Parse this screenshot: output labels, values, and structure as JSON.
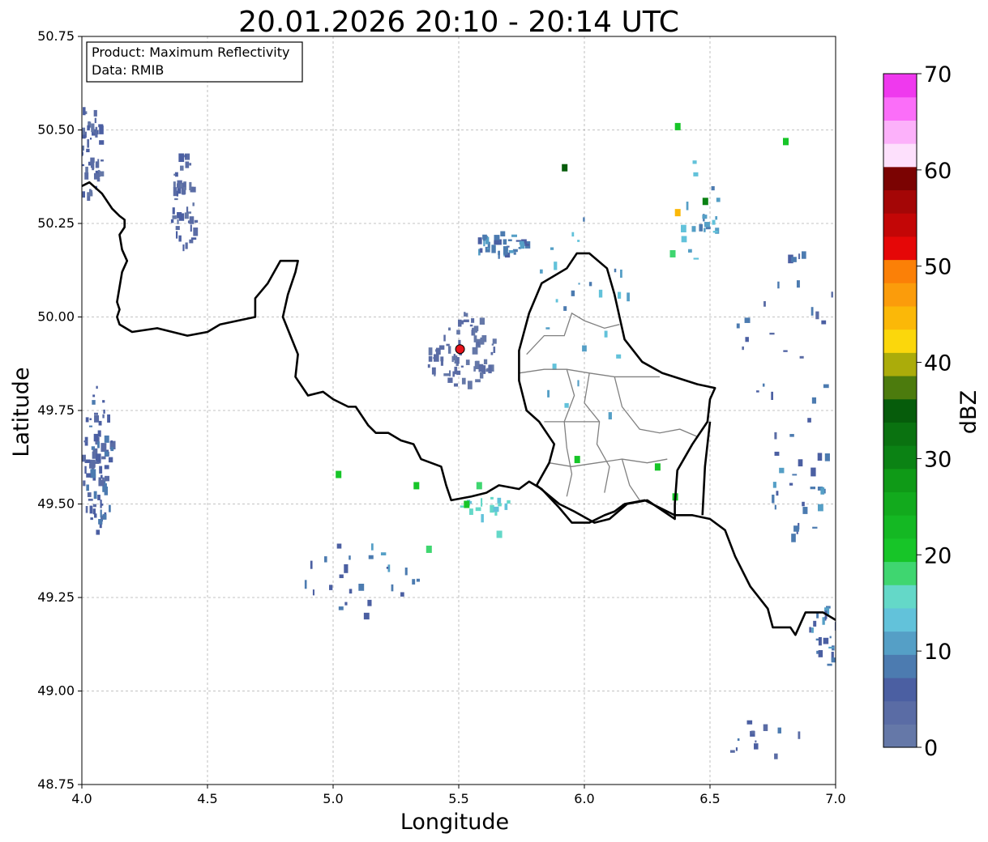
{
  "title": "20.01.2026 20:10 - 20:14 UTC",
  "info_box": {
    "product": "Product: Maximum Reflectivity",
    "data": "Data: RMIB"
  },
  "map": {
    "type": "radar-map",
    "xlabel": "Longitude",
    "ylabel": "Latitude",
    "xlim": [
      4.0,
      7.0
    ],
    "ylim": [
      48.75,
      50.75
    ],
    "xticks": [
      4.0,
      4.5,
      5.0,
      5.5,
      6.0,
      6.5,
      7.0
    ],
    "xtick_labels": [
      "4.0",
      "4.5",
      "5.0",
      "5.5",
      "6.0",
      "6.5",
      "7.0"
    ],
    "yticks": [
      48.75,
      49.0,
      49.25,
      49.5,
      49.75,
      50.0,
      50.25,
      50.5,
      50.75
    ],
    "ytick_labels": [
      "48.75",
      "49.00",
      "49.25",
      "49.50",
      "49.75",
      "50.00",
      "50.25",
      "50.50",
      "50.75"
    ],
    "grid": true,
    "radar_site": {
      "lon": 5.505,
      "lat": 49.914,
      "color": "#e8141c"
    },
    "national_border": [
      [
        4.0,
        50.35
      ],
      [
        4.03,
        50.36
      ],
      [
        4.08,
        50.33
      ],
      [
        4.12,
        50.29
      ],
      [
        4.15,
        50.27
      ],
      [
        4.17,
        50.26
      ],
      [
        4.17,
        50.24
      ],
      [
        4.15,
        50.22
      ],
      [
        4.16,
        50.18
      ],
      [
        4.18,
        50.15
      ],
      [
        4.16,
        50.12
      ],
      [
        4.14,
        50.04
      ],
      [
        4.15,
        50.02
      ],
      [
        4.14,
        50.0
      ],
      [
        4.15,
        49.98
      ],
      [
        4.2,
        49.96
      ],
      [
        4.3,
        49.97
      ],
      [
        4.42,
        49.95
      ],
      [
        4.5,
        49.96
      ],
      [
        4.55,
        49.98
      ],
      [
        4.62,
        49.99
      ],
      [
        4.69,
        50.0
      ],
      [
        4.69,
        50.05
      ],
      [
        4.74,
        50.09
      ],
      [
        4.79,
        50.15
      ],
      [
        4.86,
        50.15
      ],
      [
        4.85,
        50.12
      ],
      [
        4.82,
        50.06
      ],
      [
        4.8,
        50.0
      ],
      [
        4.83,
        49.95
      ],
      [
        4.86,
        49.9
      ],
      [
        4.85,
        49.84
      ],
      [
        4.9,
        49.79
      ],
      [
        4.96,
        49.8
      ],
      [
        5.0,
        49.78
      ],
      [
        5.06,
        49.76
      ],
      [
        5.09,
        49.76
      ],
      [
        5.14,
        49.71
      ],
      [
        5.17,
        49.69
      ],
      [
        5.22,
        49.69
      ],
      [
        5.27,
        49.67
      ],
      [
        5.32,
        49.66
      ],
      [
        5.35,
        49.62
      ],
      [
        5.43,
        49.6
      ],
      [
        5.45,
        49.55
      ],
      [
        5.47,
        49.51
      ],
      [
        5.55,
        49.52
      ],
      [
        5.61,
        49.53
      ],
      [
        5.66,
        49.55
      ],
      [
        5.74,
        49.54
      ],
      [
        5.78,
        49.56
      ],
      [
        5.83,
        49.54
      ],
      [
        5.9,
        49.49
      ],
      [
        5.95,
        49.45
      ],
      [
        5.97,
        49.45
      ],
      [
        6.02,
        49.45
      ],
      [
        6.08,
        49.47
      ],
      [
        6.12,
        49.48
      ],
      [
        6.16,
        49.5
      ],
      [
        6.24,
        49.51
      ],
      [
        6.36,
        49.47
      ],
      [
        6.43,
        49.47
      ],
      [
        6.5,
        49.46
      ],
      [
        6.56,
        49.43
      ],
      [
        6.6,
        49.36
      ],
      [
        6.66,
        49.28
      ],
      [
        6.73,
        49.22
      ],
      [
        6.75,
        49.17
      ],
      [
        6.82,
        49.17
      ],
      [
        6.84,
        49.15
      ],
      [
        6.88,
        49.21
      ],
      [
        6.95,
        49.21
      ],
      [
        7.0,
        49.19
      ]
    ],
    "luxembourg_border": [
      [
        5.81,
        49.55
      ],
      [
        5.9,
        49.5
      ],
      [
        5.96,
        49.48
      ],
      [
        6.04,
        49.45
      ],
      [
        6.1,
        49.46
      ],
      [
        6.17,
        49.5
      ],
      [
        6.25,
        49.51
      ],
      [
        6.36,
        49.46
      ],
      [
        6.36,
        49.5
      ],
      [
        6.37,
        49.59
      ],
      [
        6.43,
        49.66
      ],
      [
        6.49,
        49.72
      ],
      [
        6.5,
        49.78
      ],
      [
        6.52,
        49.81
      ],
      [
        6.45,
        49.82
      ],
      [
        6.31,
        49.85
      ],
      [
        6.23,
        49.88
      ],
      [
        6.16,
        49.94
      ],
      [
        6.14,
        50.0
      ],
      [
        6.12,
        50.06
      ],
      [
        6.09,
        50.13
      ],
      [
        6.02,
        50.17
      ],
      [
        5.97,
        50.17
      ],
      [
        5.93,
        50.13
      ],
      [
        5.83,
        50.09
      ],
      [
        5.78,
        50.01
      ],
      [
        5.74,
        49.91
      ],
      [
        5.74,
        49.83
      ],
      [
        5.77,
        49.75
      ],
      [
        5.82,
        49.72
      ],
      [
        5.88,
        49.66
      ],
      [
        5.86,
        49.61
      ],
      [
        5.81,
        49.55
      ]
    ],
    "inner_boundaries": [
      [
        [
          5.77,
          49.9
        ],
        [
          5.84,
          49.95
        ],
        [
          5.92,
          49.95
        ],
        [
          5.95,
          50.01
        ],
        [
          6.0,
          49.99
        ],
        [
          6.08,
          49.97
        ],
        [
          6.14,
          49.98
        ]
      ],
      [
        [
          5.74,
          49.85
        ],
        [
          5.84,
          49.86
        ],
        [
          5.93,
          49.86
        ],
        [
          6.02,
          49.85
        ],
        [
          6.12,
          49.84
        ],
        [
          6.22,
          49.84
        ],
        [
          6.3,
          49.84
        ]
      ],
      [
        [
          5.93,
          49.86
        ],
        [
          5.96,
          49.79
        ],
        [
          5.92,
          49.72
        ],
        [
          5.93,
          49.65
        ],
        [
          5.95,
          49.58
        ],
        [
          5.93,
          49.52
        ]
      ],
      [
        [
          6.02,
          49.85
        ],
        [
          6.0,
          49.77
        ],
        [
          6.06,
          49.72
        ],
        [
          6.05,
          49.66
        ],
        [
          6.1,
          49.6
        ],
        [
          6.08,
          49.53
        ]
      ],
      [
        [
          6.12,
          49.84
        ],
        [
          6.15,
          49.76
        ],
        [
          6.22,
          49.7
        ],
        [
          6.3,
          49.69
        ],
        [
          6.38,
          49.7
        ],
        [
          6.45,
          49.68
        ]
      ],
      [
        [
          5.84,
          49.72
        ],
        [
          5.92,
          49.72
        ],
        [
          6.0,
          49.72
        ],
        [
          6.06,
          49.72
        ]
      ],
      [
        [
          5.86,
          49.61
        ],
        [
          5.95,
          49.6
        ],
        [
          6.05,
          49.61
        ],
        [
          6.15,
          49.62
        ],
        [
          6.25,
          49.61
        ],
        [
          6.33,
          49.62
        ]
      ],
      [
        [
          6.15,
          49.62
        ],
        [
          6.18,
          49.55
        ],
        [
          6.22,
          49.51
        ]
      ]
    ],
    "echo_clusters": [
      {
        "lon": 4.02,
        "lat": 50.45,
        "rx": 0.06,
        "ry": 0.12,
        "dbz": 4,
        "n": 60
      },
      {
        "lon": 4.4,
        "lat": 50.3,
        "rx": 0.05,
        "ry": 0.15,
        "dbz": 4,
        "n": 45
      },
      {
        "lon": 4.06,
        "lat": 49.62,
        "rx": 0.06,
        "ry": 0.2,
        "dbz": 6,
        "n": 80
      },
      {
        "lon": 5.5,
        "lat": 49.92,
        "rx": 0.14,
        "ry": 0.1,
        "dbz": 2,
        "n": 70
      },
      {
        "lon": 5.67,
        "lat": 50.2,
        "rx": 0.12,
        "ry": 0.03,
        "dbz": 8,
        "n": 35
      },
      {
        "lon": 6.45,
        "lat": 50.3,
        "rx": 0.08,
        "ry": 0.15,
        "dbz": 12,
        "n": 20
      },
      {
        "lon": 6.85,
        "lat": 49.55,
        "rx": 0.12,
        "ry": 0.2,
        "dbz": 8,
        "n": 25
      },
      {
        "lon": 6.95,
        "lat": 49.15,
        "rx": 0.06,
        "ry": 0.08,
        "dbz": 8,
        "n": 25
      },
      {
        "lon": 5.6,
        "lat": 49.5,
        "rx": 0.1,
        "ry": 0.03,
        "dbz": 15,
        "n": 15
      },
      {
        "lon": 5.1,
        "lat": 49.3,
        "rx": 0.25,
        "ry": 0.1,
        "dbz": 8,
        "n": 25
      },
      {
        "lon": 6.0,
        "lat": 50.0,
        "rx": 0.2,
        "ry": 0.3,
        "dbz": 12,
        "n": 25
      },
      {
        "lon": 6.7,
        "lat": 48.88,
        "rx": 0.2,
        "ry": 0.05,
        "dbz": 6,
        "n": 12
      },
      {
        "lon": 6.8,
        "lat": 49.95,
        "rx": 0.2,
        "ry": 0.3,
        "dbz": 6,
        "n": 25
      }
    ],
    "echo_points": [
      [
        6.48,
        50.31,
        30
      ],
      [
        6.37,
        50.28,
        45
      ],
      [
        5.92,
        50.4,
        35
      ],
      [
        6.37,
        50.51,
        22
      ],
      [
        6.36,
        49.52,
        22
      ],
      [
        5.97,
        49.62,
        20
      ],
      [
        6.8,
        50.47,
        22
      ],
      [
        5.38,
        49.38,
        18
      ],
      [
        5.53,
        49.5,
        20
      ],
      [
        5.33,
        49.55,
        22
      ],
      [
        5.02,
        49.58,
        22
      ],
      [
        6.35,
        50.17,
        18
      ],
      [
        6.29,
        49.6,
        22
      ],
      [
        5.58,
        49.55,
        18
      ],
      [
        5.66,
        49.42,
        16
      ]
    ]
  },
  "colorbar": {
    "label": "dBZ",
    "min": 0,
    "max": 70,
    "step": 2.5,
    "tick_values": [
      0,
      10,
      20,
      30,
      40,
      50,
      60,
      70
    ],
    "tick_labels": [
      "0",
      "10",
      "20",
      "30",
      "40",
      "50",
      "60",
      "70"
    ],
    "colors": [
      "#6578a8",
      "#5a6ca5",
      "#4b5fa2",
      "#4c7bb0",
      "#559fc6",
      "#62c2da",
      "#64d8c8",
      "#3fd670",
      "#17c528",
      "#14b823",
      "#12aa1d",
      "#0f9a17",
      "#0b8214",
      "#0a7210",
      "#065c0b",
      "#4c7b0d",
      "#abac0a",
      "#fbd70c",
      "#fbb808",
      "#fb9c0b",
      "#fb8007",
      "#e50707",
      "#c30606",
      "#a40606",
      "#7b0302",
      "#fde0fc",
      "#fcb1fa",
      "#fb6ef9",
      "#ef39ee"
    ]
  }
}
